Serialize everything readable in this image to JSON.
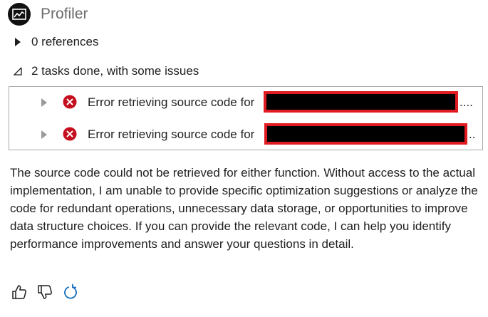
{
  "header": {
    "title": "Profiler",
    "avatar_icon": "chart-line-icon"
  },
  "references": {
    "label": "0 references",
    "expanded": false
  },
  "tasks": {
    "label": "2 tasks done, with some issues",
    "expanded": true,
    "items": [
      {
        "text": "Error retrieving source code for",
        "tail": "....",
        "status": "error"
      },
      {
        "text": "Error retrieving source code for",
        "tail": "..",
        "status": "error"
      }
    ]
  },
  "message": "The source code could not be retrieved for either function. Without access to the actual implementation, I am unable to provide specific optimization suggestions or analyze the code for redundant operations, unnecessary data storage, or opportunities to improve data structure choices. If you can provide the relevant code, I can help you identify performance improvements and answer your questions in detail.",
  "colors": {
    "error": "#c50f1f",
    "redaction_border": "#e01b22",
    "accent": "#0f6cbd"
  },
  "actions": [
    "thumbs-up-icon",
    "thumbs-down-icon",
    "retry-icon"
  ]
}
